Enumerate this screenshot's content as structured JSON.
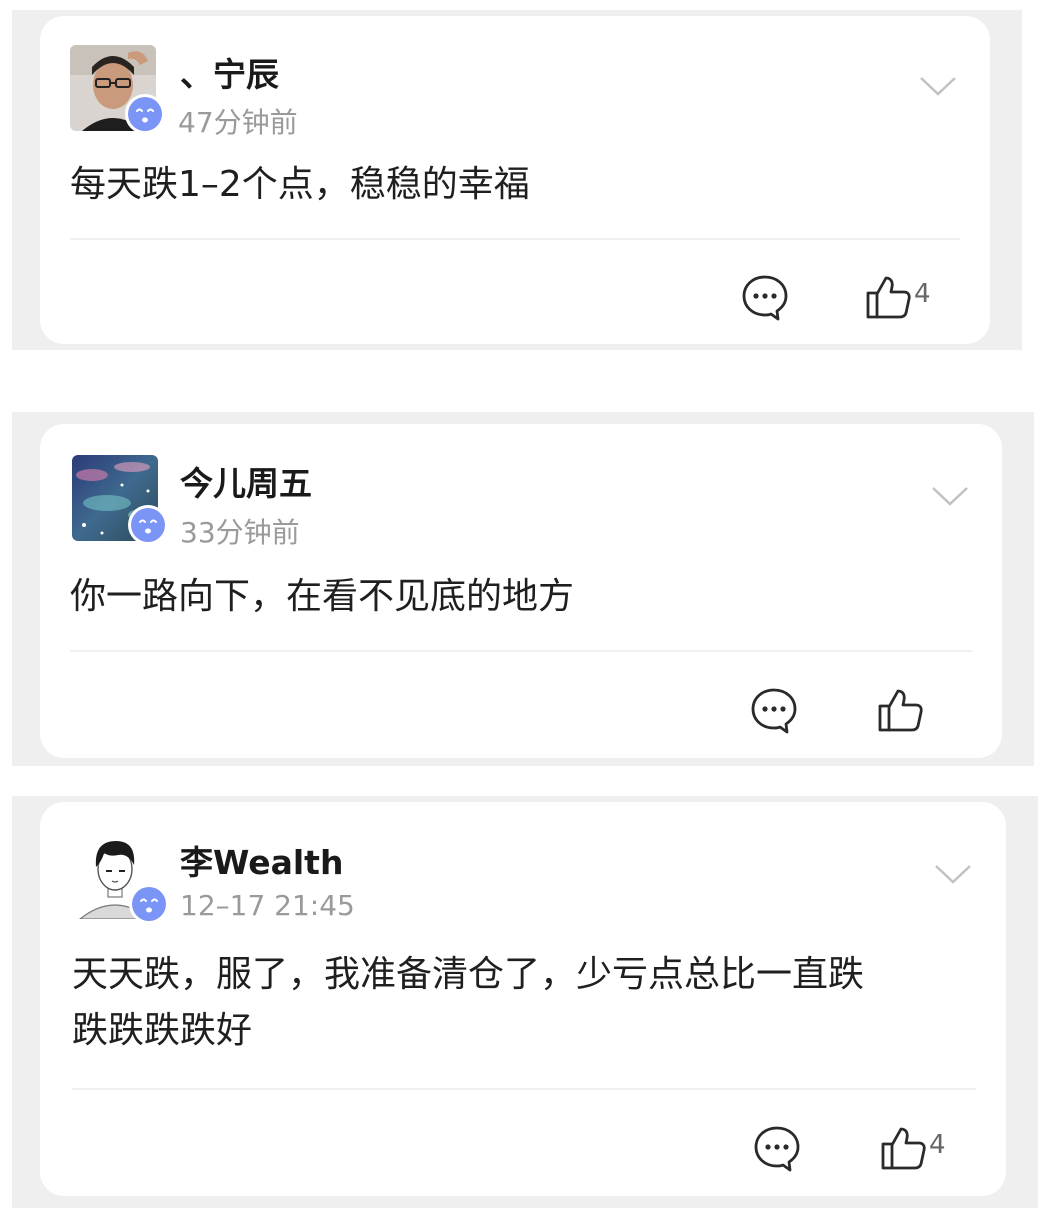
{
  "posts": [
    {
      "username": "、宁辰",
      "time": "47分钟前",
      "content": "每天跌1–2个点，稳稳的幸福",
      "likes": "4"
    },
    {
      "username": "今儿周五",
      "time": "33分钟前",
      "content": "你一路向下，在看不见底的地方",
      "likes": ""
    },
    {
      "username": "李Wealth",
      "time": "12–17 21:45",
      "content_line1": "天天跌，服了，我准备清仓了，少亏点总比一直跌",
      "content_line2": "跌跌跌跌好",
      "likes": "4"
    }
  ],
  "icons": {
    "badge": "smiling-face-icon",
    "more": "chevron-down-icon",
    "comment": "comment-bubble-icon",
    "like": "thumbs-up-icon"
  },
  "colors": {
    "badge_fill": "#7b95f7",
    "text_primary": "#1a1a1a",
    "text_secondary": "#9a9a9a",
    "panel_bg": "#efefef"
  }
}
